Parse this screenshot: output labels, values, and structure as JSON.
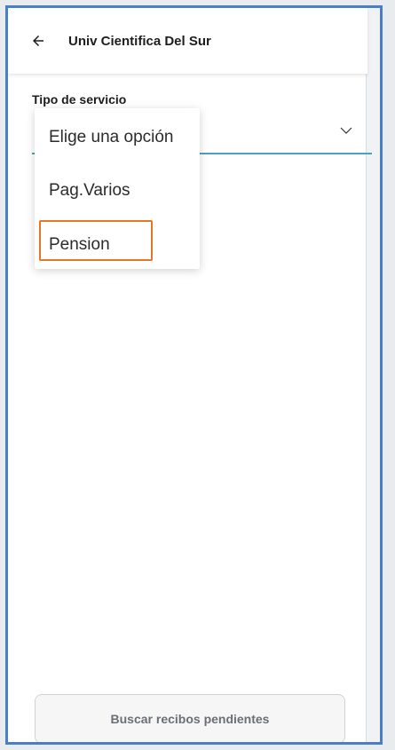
{
  "header": {
    "title": "Univ Cientifica Del Sur",
    "back_icon": "arrow-left-icon"
  },
  "form": {
    "label": "Tipo de servicio",
    "chevron_icon": "chevron-down-icon",
    "accent_color": "#4aa3b8"
  },
  "dropdown": {
    "options": [
      {
        "label": "Elige una opción"
      },
      {
        "label": "Pag.Varios"
      },
      {
        "label": "Pension",
        "highlighted": true
      }
    ],
    "highlight_color": "#e3782a"
  },
  "footer": {
    "button_label": "Buscar recibos pendientes"
  },
  "frame": {
    "border_color": "#4a7fc1"
  }
}
